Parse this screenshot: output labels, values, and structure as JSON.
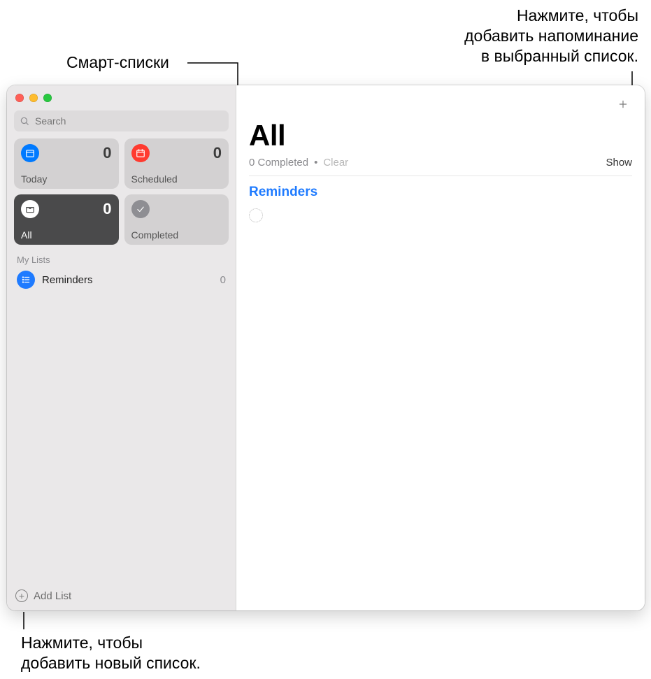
{
  "callouts": {
    "smart_lists": "Смарт-списки",
    "add_reminder": "Нажмите, чтобы\nдобавить напоминание\nв выбранный список.",
    "add_list": "Нажмите, чтобы\nдобавить новый список."
  },
  "sidebar": {
    "search_placeholder": "Search",
    "smart": [
      {
        "key": "today",
        "label": "Today",
        "count": 0,
        "icon": "calendar-today-icon",
        "selected": false
      },
      {
        "key": "scheduled",
        "label": "Scheduled",
        "count": 0,
        "icon": "calendar-icon",
        "selected": false
      },
      {
        "key": "all",
        "label": "All",
        "count": 0,
        "icon": "inbox-icon",
        "selected": true
      },
      {
        "key": "completed",
        "label": "Completed",
        "count": "",
        "icon": "checkmark-icon",
        "selected": false
      }
    ],
    "my_lists_header": "My Lists",
    "lists": [
      {
        "name": "Reminders",
        "count": 0
      }
    ],
    "add_list_label": "Add List"
  },
  "main": {
    "title": "All",
    "completed_text": "0 Completed",
    "clear_label": "Clear",
    "show_label": "Show",
    "group_title": "Reminders"
  }
}
